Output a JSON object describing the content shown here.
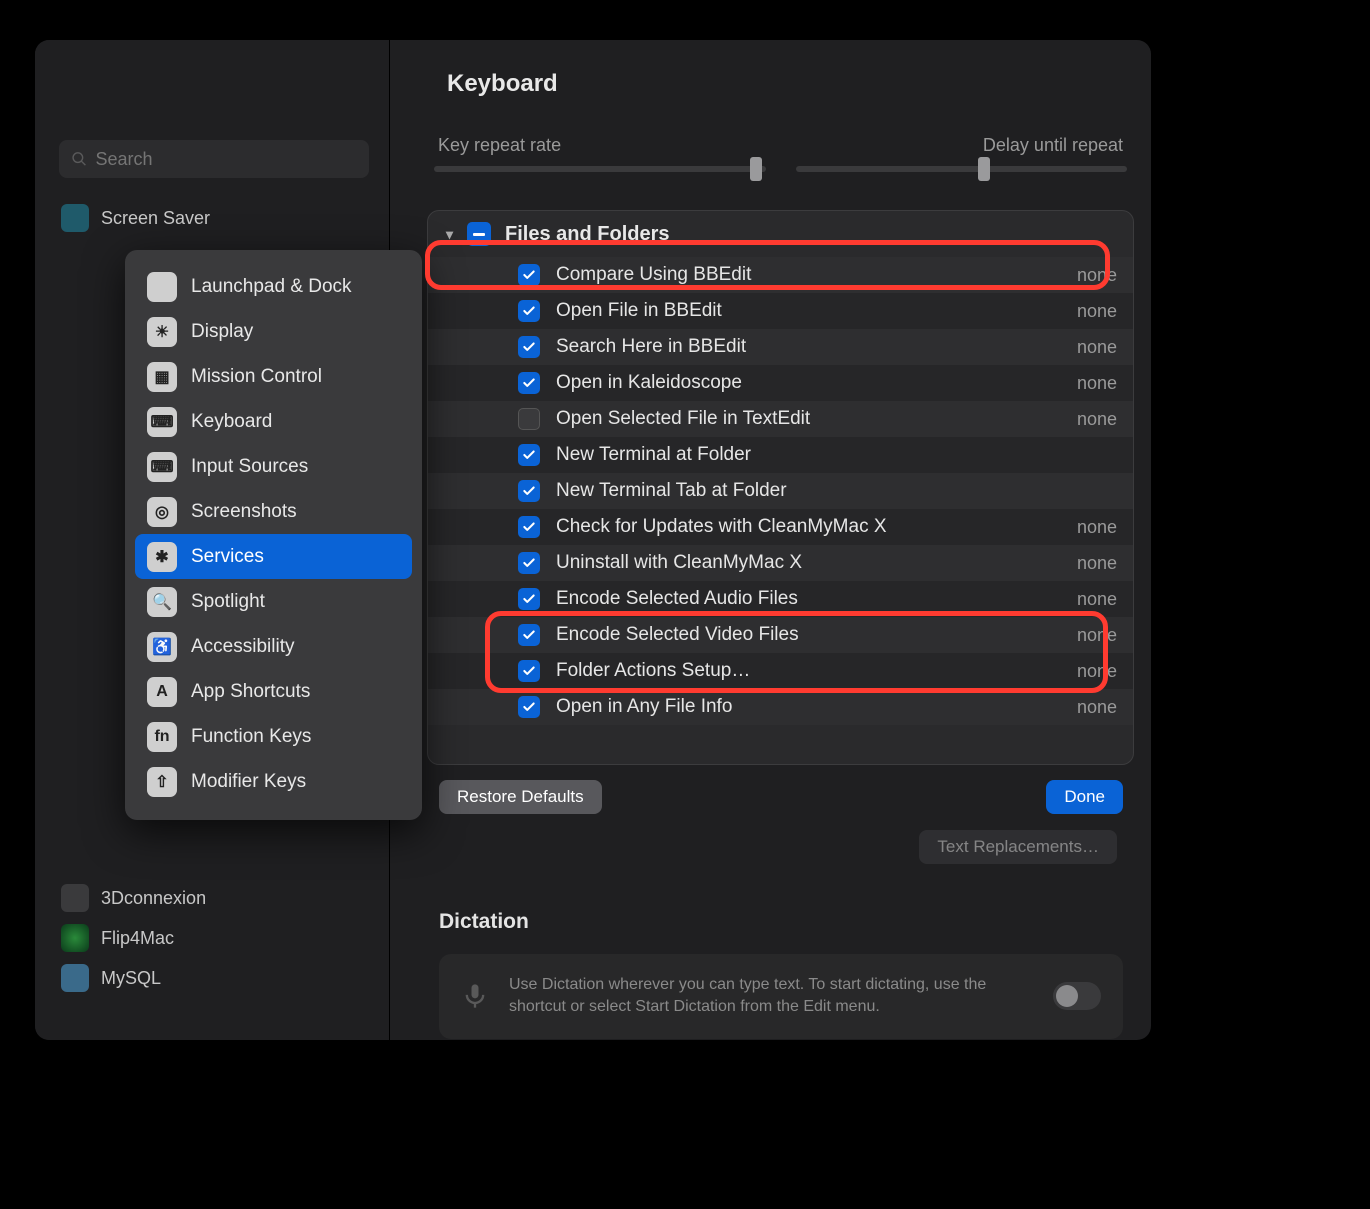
{
  "search": {
    "placeholder": "Search"
  },
  "page": {
    "title": "Keyboard"
  },
  "sliders": {
    "label_left": "Key repeat rate",
    "label_right": "Delay until repeat"
  },
  "background_sidebar": {
    "item_before": "Screen Saver",
    "items_after": [
      "3Dconnexion",
      "Flip4Mac",
      "MySQL"
    ]
  },
  "menu": {
    "items": [
      {
        "label": "Launchpad & Dock",
        "icon": "launchpad-icon",
        "cls": "ic-launchpad",
        "glyph": ""
      },
      {
        "label": "Display",
        "icon": "display-icon",
        "cls": "ic-display",
        "glyph": "☀"
      },
      {
        "label": "Mission Control",
        "icon": "mc-icon",
        "cls": "ic-mc",
        "glyph": "▦"
      },
      {
        "label": "Keyboard",
        "icon": "keyboard-icon",
        "cls": "ic-kb",
        "glyph": "⌨"
      },
      {
        "label": "Input Sources",
        "icon": "input-icon",
        "cls": "ic-is",
        "glyph": "⌨"
      },
      {
        "label": "Screenshots",
        "icon": "screenshots-icon",
        "cls": "ic-ss",
        "glyph": "◎"
      },
      {
        "label": "Services",
        "icon": "services-icon",
        "cls": "ic-svc",
        "glyph": "✱",
        "selected": true
      },
      {
        "label": "Spotlight",
        "icon": "spotlight-icon",
        "cls": "ic-spot",
        "glyph": "🔍"
      },
      {
        "label": "Accessibility",
        "icon": "accessibility-icon",
        "cls": "ic-acc",
        "glyph": "♿"
      },
      {
        "label": "App Shortcuts",
        "icon": "appshortcuts-icon",
        "cls": "ic-appsc",
        "glyph": "A"
      },
      {
        "label": "Function Keys",
        "icon": "fnkeys-icon",
        "cls": "ic-fn",
        "glyph": "fn"
      },
      {
        "label": "Modifier Keys",
        "icon": "modkeys-icon",
        "cls": "ic-mod",
        "glyph": "⇧"
      }
    ]
  },
  "services_group": {
    "title": "Files and Folders",
    "rows": [
      {
        "name": "Compare Using BBEdit",
        "checked": true,
        "shortcut": "none"
      },
      {
        "name": "Open File in BBEdit",
        "checked": true,
        "shortcut": "none"
      },
      {
        "name": "Search Here in BBEdit",
        "checked": true,
        "shortcut": "none"
      },
      {
        "name": "Open in Kaleidoscope",
        "checked": true,
        "shortcut": "none"
      },
      {
        "name": "Open Selected File in TextEdit",
        "checked": false,
        "shortcut": "none"
      },
      {
        "name": "New Terminal at Folder",
        "checked": true,
        "shortcut": ""
      },
      {
        "name": "New Terminal Tab at Folder",
        "checked": true,
        "shortcut": ""
      },
      {
        "name": "Check for Updates with CleanMyMac X",
        "checked": true,
        "shortcut": "none"
      },
      {
        "name": "Uninstall with CleanMyMac X",
        "checked": true,
        "shortcut": "none"
      },
      {
        "name": "Encode Selected Audio Files",
        "checked": true,
        "shortcut": "none"
      },
      {
        "name": "Encode Selected Video Files",
        "checked": true,
        "shortcut": "none"
      },
      {
        "name": "Folder Actions Setup…",
        "checked": true,
        "shortcut": "none"
      },
      {
        "name": "Open in Any File Info",
        "checked": true,
        "shortcut": "none"
      }
    ]
  },
  "buttons": {
    "restore": "Restore Defaults",
    "done": "Done",
    "text_replacements": "Text Replacements…"
  },
  "dictation": {
    "title": "Dictation",
    "body": "Use Dictation wherever you can type text. To start dictating, use the shortcut or select Start Dictation from the Edit menu."
  }
}
